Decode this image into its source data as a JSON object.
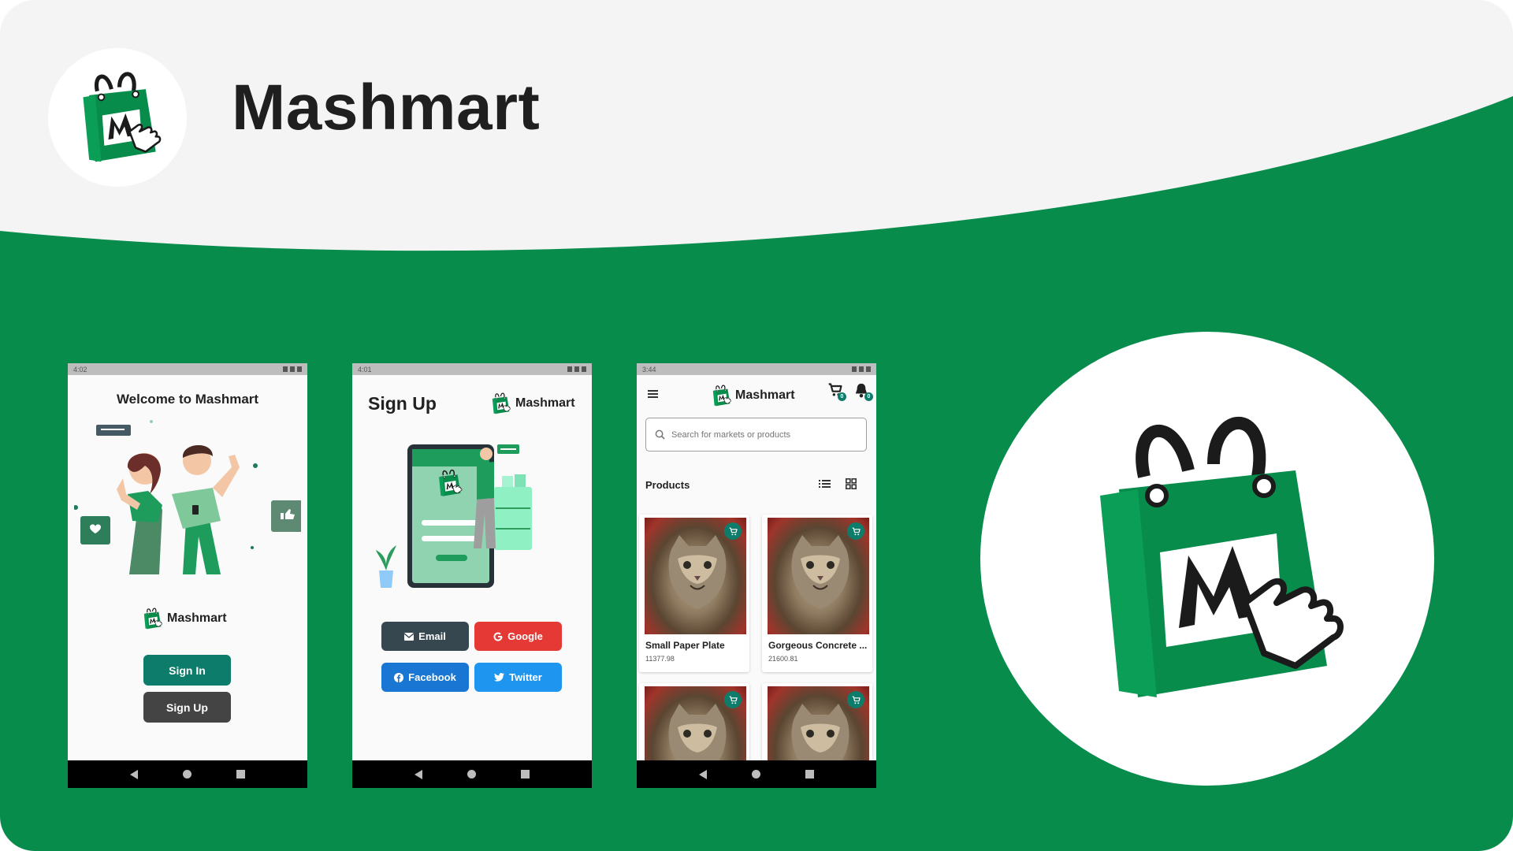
{
  "app": {
    "title": "Mashmart",
    "brand_color": "#078c4c",
    "accent_teal": "#0e7c6b"
  },
  "screen1": {
    "status_time": "4:02",
    "heading": "Welcome to Mashmart",
    "brand": "Mashmart",
    "sign_in_label": "Sign In",
    "sign_up_label": "Sign Up"
  },
  "screen2": {
    "status_time": "4:01",
    "heading": "Sign Up",
    "brand": "Mashmart",
    "email_label": "Email",
    "google_label": "Google",
    "facebook_label": "Facebook",
    "twitter_label": "Twitter"
  },
  "screen3": {
    "status_time": "3:44",
    "brand": "Mashmart",
    "cart_count": "0",
    "notification_count": "0",
    "search_placeholder": "Search for markets or products",
    "section_label": "Products",
    "products": [
      {
        "name": "Small Paper Plate",
        "price": "11377.98"
      },
      {
        "name": "Gorgeous Concrete ...",
        "price": "21600.81"
      },
      {
        "name": "",
        "price": ""
      },
      {
        "name": "",
        "price": ""
      }
    ]
  },
  "icons": {
    "bag_logo": "shopping-bag-m-logo",
    "cart": "cart-icon",
    "bell": "bell-icon",
    "search": "search-icon",
    "menu": "menu-icon"
  }
}
